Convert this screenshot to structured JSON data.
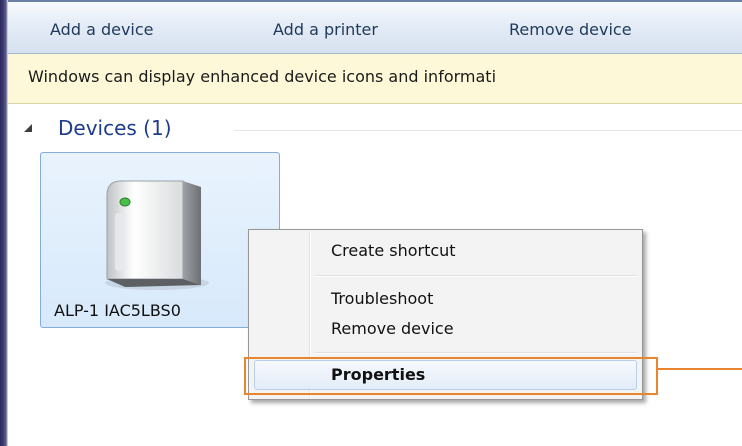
{
  "toolbar": {
    "add_device": "Add a device",
    "add_printer": "Add a printer",
    "remove_device": "Remove device"
  },
  "infobar": {
    "message": "Windows can display enhanced device icons and informati"
  },
  "group": {
    "title": "Devices (1)"
  },
  "device": {
    "name": "ALP-1 IAC5LBS0",
    "icon": "computer-tower-icon"
  },
  "context_menu": {
    "items": [
      {
        "label": "Create shortcut"
      },
      {
        "label": "Troubleshoot"
      },
      {
        "label": "Remove device"
      },
      {
        "label": "Properties",
        "bold": true,
        "highlighted": true
      }
    ]
  },
  "colors": {
    "highlight_outline": "#e9842f",
    "group_title": "#1e3c8c",
    "infobar_background": "#fdf9d8"
  }
}
